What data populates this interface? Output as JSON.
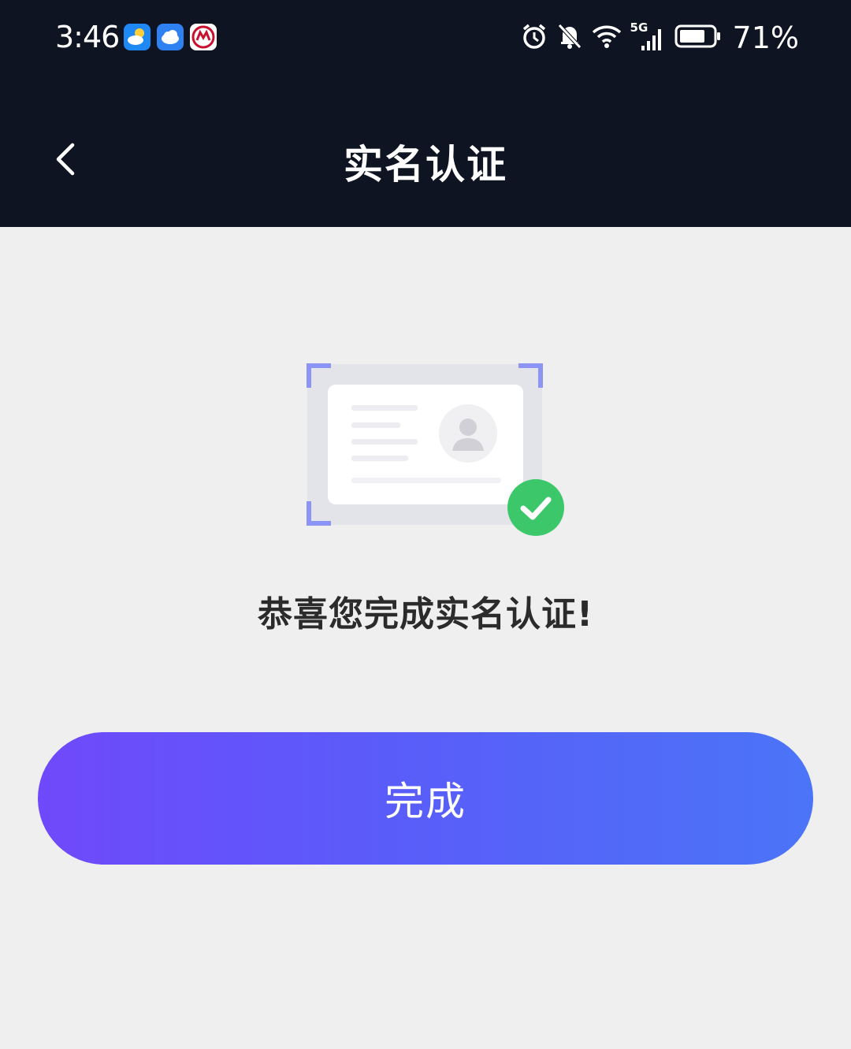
{
  "status_bar": {
    "time": "3:46",
    "battery_percent": "71%",
    "network_label": "5G",
    "app_icons": [
      "weather-icon",
      "cloud-icon",
      "bank-icon"
    ],
    "system_icons": [
      "alarm-icon",
      "bell-muted-icon",
      "wifi-icon",
      "signal-icon",
      "battery-icon"
    ]
  },
  "header": {
    "title": "实名认证",
    "back_icon": "chevron-left-icon"
  },
  "main": {
    "illustration": "id-card-verified-illustration",
    "success_message": "恭喜您完成实名认证!",
    "done_label": "完成"
  },
  "colors": {
    "header_bg": "#0f1422",
    "page_bg": "#efefef",
    "button_gradient_start": "#6f49fb",
    "button_gradient_end": "#4b74f8",
    "check_green": "#3cc86a",
    "frame_corner": "#8c95f5"
  }
}
